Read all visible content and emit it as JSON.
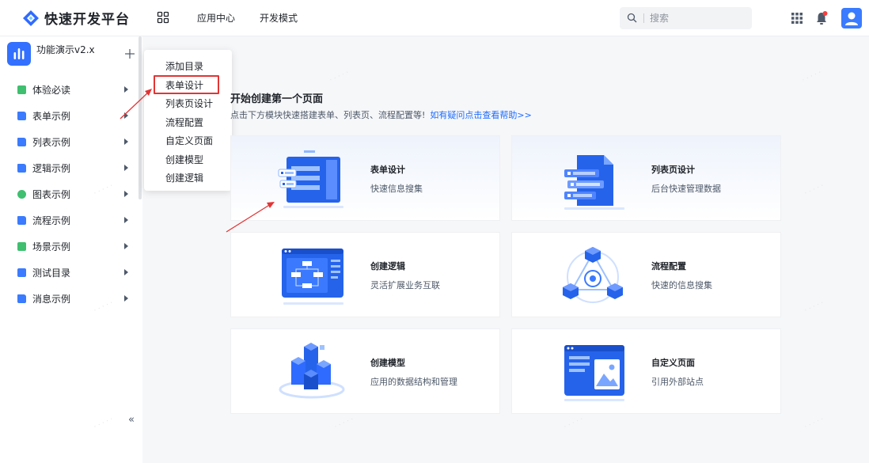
{
  "header": {
    "logo_text": "快速开发平台",
    "nav": [
      "应用中心",
      "开发模式"
    ],
    "search_placeholder": "搜索"
  },
  "sidebar": {
    "app_name": "功能演示v2.x",
    "collapse_glyph": "«",
    "items": [
      {
        "label": "体验必读",
        "icon_color": "#3fbf6f"
      },
      {
        "label": "表单示例",
        "icon_color": "#3a7bff"
      },
      {
        "label": "列表示例",
        "icon_color": "#3a7bff"
      },
      {
        "label": "逻辑示例",
        "icon_color": "#3a7bff"
      },
      {
        "label": "图表示例",
        "icon_color": "#3fbf6f"
      },
      {
        "label": "流程示例",
        "icon_color": "#3a7bff"
      },
      {
        "label": "场景示例",
        "icon_color": "#3fbf6f"
      },
      {
        "label": "测试目录",
        "icon_color": "#3a7bff"
      },
      {
        "label": "消息示例",
        "icon_color": "#3a7bff"
      }
    ]
  },
  "dropdown": {
    "items": [
      "添加目录",
      "表单设计",
      "列表页设计",
      "流程配置",
      "自定义页面",
      "创建模型",
      "创建逻辑"
    ],
    "highlight_index": 1,
    "highlight_color": "#e23434"
  },
  "main": {
    "title": "开始创建第一个页面",
    "subtitle": "点击下方模块快速搭建表单、列表页、流程配置等!",
    "help_link": "如有疑问点击查看帮助>>",
    "cards": [
      {
        "title": "表单设计",
        "desc": "快速信息搜集"
      },
      {
        "title": "列表页设计",
        "desc": "后台快速管理数据"
      },
      {
        "title": "创建逻辑",
        "desc": "灵活扩展业务互联"
      },
      {
        "title": "流程配置",
        "desc": "快速的信息搜集"
      },
      {
        "title": "创建模型",
        "desc": "应用的数据结构和管理"
      },
      {
        "title": "自定义页面",
        "desc": "引用外部站点"
      }
    ]
  },
  "colors": {
    "brand": "#3370ff",
    "link": "#1e6cff",
    "annotation_arrow": "#e23434"
  }
}
